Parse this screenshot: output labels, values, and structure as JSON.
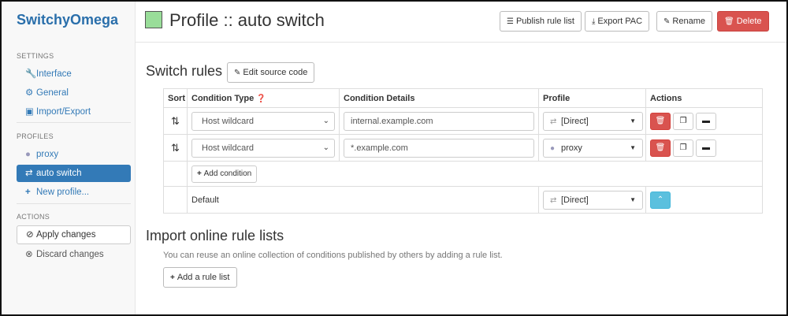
{
  "sidebar": {
    "brand": "SwitchyOmega",
    "settings_header": "SETTINGS",
    "settings_items": [
      {
        "label": "Interface",
        "icon": "wrench-icon",
        "glyph": "🔧"
      },
      {
        "label": "General",
        "icon": "gear-icon",
        "glyph": "⚙"
      },
      {
        "label": "Import/Export",
        "icon": "floppy-icon",
        "glyph": "💾"
      }
    ],
    "profiles_header": "PROFILES",
    "profile_items": [
      {
        "label": "proxy",
        "icon": "globe-icon",
        "glyph": "●"
      },
      {
        "label": "auto switch",
        "icon": "retweet-icon",
        "glyph": "⇄",
        "active": true
      },
      {
        "label": "New profile...",
        "icon": "plus-icon",
        "glyph": "+"
      }
    ],
    "actions_header": "ACTIONS",
    "apply_label": "Apply changes",
    "discard_label": "Discard changes"
  },
  "header": {
    "title": "Profile :: auto switch",
    "swatch_color": "#99dd99",
    "buttons": {
      "publish": "Publish rule list",
      "export": "Export PAC",
      "rename": "Rename",
      "delete": "Delete"
    }
  },
  "switch_rules": {
    "title": "Switch rules",
    "edit_source": "Edit source code",
    "columns": {
      "sort": "Sort",
      "condition_type": "Condition Type",
      "condition_details": "Condition Details",
      "profile": "Profile",
      "actions": "Actions"
    },
    "rows": [
      {
        "type": "Host wildcard",
        "details": "internal.example.com",
        "profile": "[Direct]"
      },
      {
        "type": "Host wildcard",
        "details": "*.example.com",
        "profile": "proxy"
      }
    ],
    "add_condition": "Add condition",
    "default_label": "Default",
    "default_profile": "[Direct]"
  },
  "import": {
    "title": "Import online rule lists",
    "description": "You can reuse an online collection of conditions published by others by adding a rule list.",
    "add_button": "Add a rule list"
  },
  "colors": {
    "brand": "#2a6fab",
    "active_nav": "#337ab7",
    "danger": "#d9534f",
    "info": "#5bc0de"
  }
}
